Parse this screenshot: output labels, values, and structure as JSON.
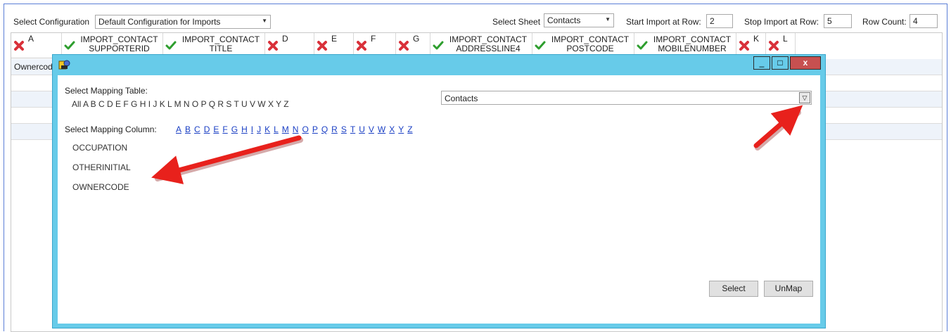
{
  "toolbar": {
    "config_label": "Select Configuration",
    "config_value": "Default Configuration for Imports",
    "sheet_label": "Select Sheet",
    "sheet_value": "Contacts",
    "start_label": "Start Import at Row:",
    "start_value": "2",
    "stop_label": "Stop Import at Row:",
    "stop_value": "5",
    "count_label": "Row Count:",
    "count_value": "4"
  },
  "columns": [
    {
      "status": "unmapped",
      "line1": "A",
      "line2": ""
    },
    {
      "status": "mapped",
      "line1": "IMPORT_CONTACT",
      "line2": "SUPPORTERID"
    },
    {
      "status": "mapped",
      "line1": "IMPORT_CONTACT",
      "line2": "TITLE"
    },
    {
      "status": "unmapped",
      "line1": "D",
      "line2": ""
    },
    {
      "status": "unmapped",
      "line1": "E",
      "line2": ""
    },
    {
      "status": "unmapped",
      "line1": "F",
      "line2": ""
    },
    {
      "status": "unmapped",
      "line1": "G",
      "line2": ""
    },
    {
      "status": "mapped",
      "line1": "IMPORT_CONTACT",
      "line2": "ADDRESSLINE4"
    },
    {
      "status": "mapped",
      "line1": "IMPORT_CONTACT",
      "line2": "POSTCODE"
    },
    {
      "status": "mapped",
      "line1": "IMPORT_CONTACT",
      "line2": "MOBILENUMBER"
    },
    {
      "status": "unmapped",
      "line1": "K",
      "line2": ""
    },
    {
      "status": "unmapped",
      "line1": "L",
      "line2": ""
    }
  ],
  "grid": {
    "first_cell": "Ownercode"
  },
  "dialog": {
    "mapping_table_label": "Select Mapping Table:",
    "table_letters": "All A B C D E F G H I J K L M N O P Q R S T U V W X Y Z",
    "table_value": "Contacts",
    "mapping_column_label": "Select Mapping Column:",
    "column_letters": [
      "A",
      "B",
      "C",
      "D",
      "E",
      "F",
      "G",
      "H",
      "I",
      "J",
      "K",
      "L",
      "M",
      "N",
      "O",
      "P",
      "Q",
      "R",
      "S",
      "T",
      "U",
      "V",
      "W",
      "X",
      "Y",
      "Z"
    ],
    "columns": [
      "OCCUPATION",
      "OTHERINITIAL",
      "OWNERCODE"
    ],
    "select_label": "Select",
    "unmap_label": "UnMap",
    "minimize_glyph": "_",
    "maximize_glyph": "□",
    "close_glyph": "x"
  },
  "colors": {
    "dialog_frame": "#67cbe9",
    "close_button": "#c75050",
    "arrow": "#e8211c",
    "mapped_icon": "#2e9e2e",
    "unmapped_icon": "#d9313a"
  },
  "icons": {
    "mapped": "check-icon",
    "unmapped": "cross-icon",
    "dialog_app": "gear-icon"
  }
}
